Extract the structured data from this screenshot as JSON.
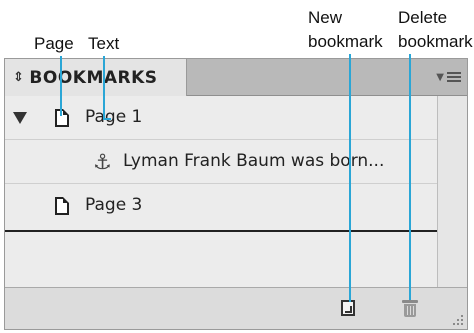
{
  "callouts": {
    "page": "Page",
    "text": "Text",
    "new_bookmark_line1": "New",
    "new_bookmark_line2": "bookmark",
    "delete_bookmark_line1": "Delete",
    "delete_bookmark_line2": "bookmark"
  },
  "panel": {
    "title": "BOOKMARKS",
    "title_icon": "updown-chevron-icon",
    "menu_icon": "panel-menu-icon",
    "items": [
      {
        "label": "Page 1",
        "icon": "page-icon",
        "expanded": true
      },
      {
        "label": "Lyman Frank Baum was born...",
        "icon": "anchor-icon"
      },
      {
        "label": "Page 3",
        "icon": "page-icon"
      }
    ]
  },
  "toolbar": {
    "new_icon": "new-bookmark-icon",
    "delete_icon": "trash-icon"
  },
  "colors": {
    "leader": "#2aa6d6",
    "panel_bg": "#e4e4e4"
  }
}
